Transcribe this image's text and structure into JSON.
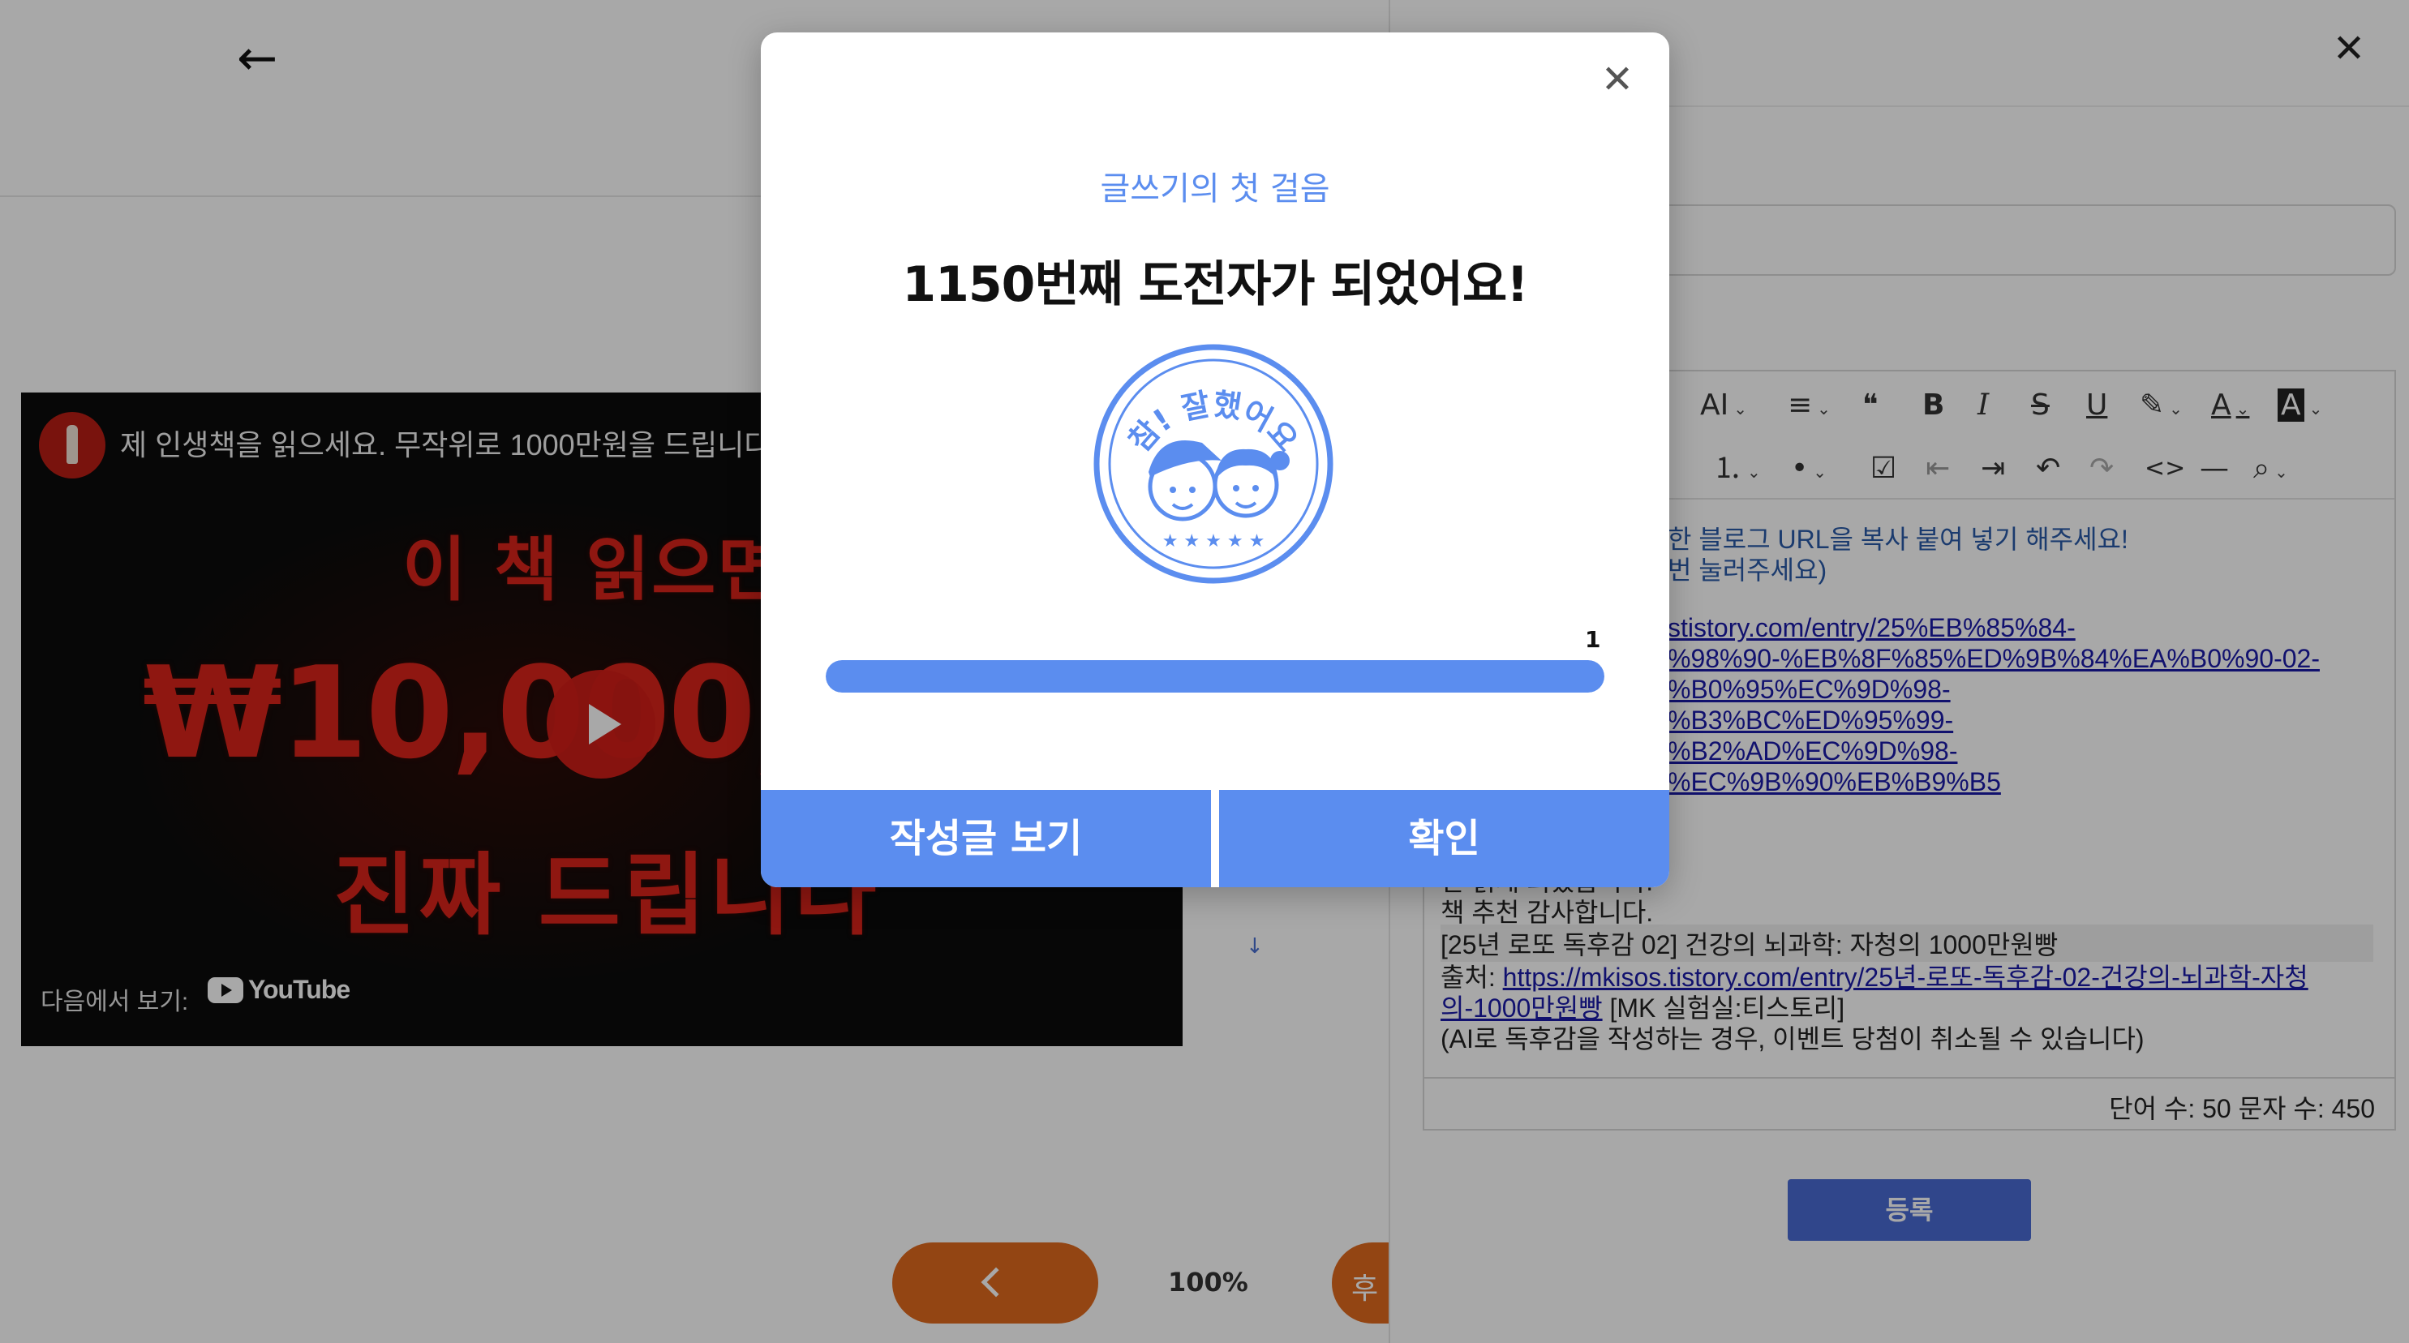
{
  "colors": {
    "accent_blue": "#5b8def",
    "submit_blue": "#4a6bd4",
    "orange": "#e0691e",
    "link_blue": "#1a1aa8",
    "thumb_red": "#d9241b"
  },
  "left_pane": {
    "back_icon": "←",
    "video": {
      "title": "제 인생책을 읽으세요. 무작위로 1000만원을 드립니다. (",
      "thumb_line1": "이 책 읽으면",
      "thumb_line2": "₩10,000,",
      "thumb_line3": "진짜 드립니다",
      "watch_on": "다음에서 보기:",
      "platform": "YouTube"
    },
    "zoom": "100%",
    "next_partial": "후"
  },
  "right_pane": {
    "close_icon": "✕",
    "toolbar": {
      "font_size": "A",
      "bold": "B",
      "italic": "I",
      "strike": "S",
      "underline": "U",
      "font_color": "A",
      "bg_color": "A",
      "quote": "❝",
      "align": "≡",
      "ordered": "⒈",
      "bullet": "•",
      "checklist": "☑",
      "outdent": "⇤",
      "indent": "⇥",
      "undo": "↶",
      "redo": "↷",
      "code": "<>",
      "hr": "—",
      "find": "⌕",
      "dropdown": "⌄"
    },
    "editor_lines": {
      "l1": "한 블로그 URL을 복사 붙여 넣기 해주세요!",
      "l2": "번 눌러주세요)",
      "link1": "stistory.com/entry/25%EB%85%84-",
      "link2": "%98%90-%EB%8F%85%ED%9B%84%EA%B0%90-02-",
      "link3": "%B0%95%EC%9D%98-",
      "link4": "%B3%BC%ED%95%99-",
      "link5": "%B2%AD%EC%9D%98-",
      "link6": "%EC%9B%90%EB%B9%B5",
      "partial": "한 읽게 되었습니다.",
      "thanks": "책 추천 감사합니다.",
      "post_title": "[25년 로또 독후감 02] 건강의 뇌과학: 자청의 1000만원빵",
      "source_label": "출처:",
      "source_link": "https://mkisos.tistory.com/entry/25년-로또-독후감-02-건강의-뇌과학-자청",
      "source_link2": "의-1000만원빵",
      "source_site": "[MK 실험실:티스토리]",
      "notice": "(AI로 독후감을 작성하는 경우, 이벤트 당첨이 취소될 수 있습니다)"
    },
    "word_count": "단어 수: 50  문자 수: 450",
    "dash_marker": "↓",
    "submit_label": "등록"
  },
  "modal": {
    "close_icon": "✕",
    "subtitle": "글쓰기의 첫 걸음",
    "title": "1150번째 도전자가 되었어요!",
    "stamp_text": "참! 잘했어요",
    "progress_label": "1",
    "progress_value": 1.0,
    "buttons": {
      "view_post": "작성글 보기",
      "confirm": "확인"
    }
  }
}
